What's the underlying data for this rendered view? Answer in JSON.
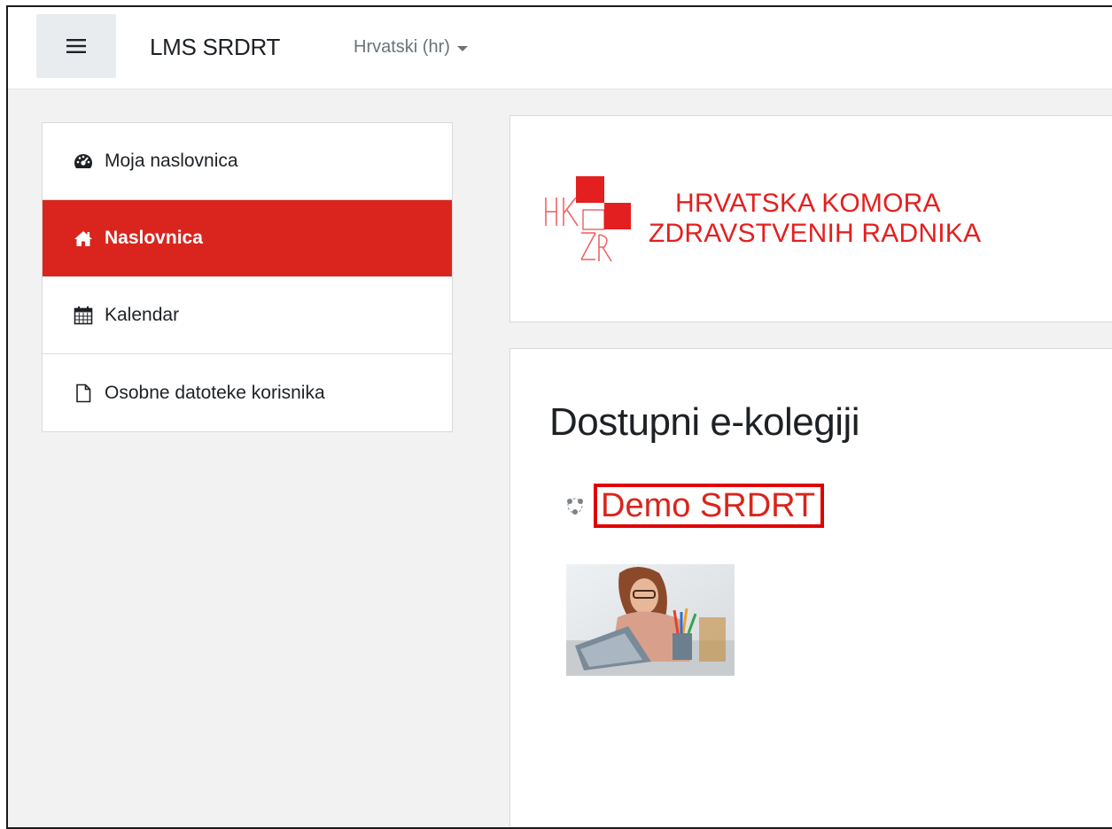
{
  "navbar": {
    "menu_icon": "hamburger-icon",
    "brand": "LMS SRDRT",
    "language": "Hrvatski (hr)"
  },
  "sidebar": {
    "items": [
      {
        "label": "Moja naslovnica",
        "icon": "dashboard-icon",
        "active": false
      },
      {
        "label": "Naslovnica",
        "icon": "home-icon",
        "active": true
      },
      {
        "label": "Kalendar",
        "icon": "calendar-icon",
        "active": false
      },
      {
        "label": "Osobne datoteke korisnika",
        "icon": "file-icon",
        "active": false
      }
    ]
  },
  "logo": {
    "line1": "HRVATSKA KOMORA",
    "line2": "ZDRAVSTVENIH RADNIKA",
    "mark": "HKZR"
  },
  "courses": {
    "title": "Dostupni e-kolegiji",
    "items": [
      {
        "name": "Demo SRDRT",
        "icon": "course-icon",
        "image": "course-thumbnail-image"
      }
    ]
  },
  "colors": {
    "accent": "#d9251d",
    "highlight_border": "#e00000",
    "logo_red": "#e41f1f"
  }
}
